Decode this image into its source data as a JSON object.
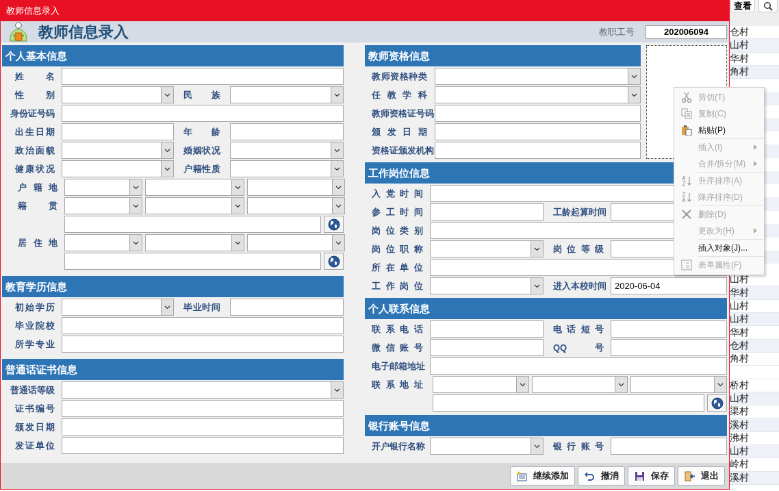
{
  "window": {
    "title": "教师信息录入"
  },
  "header": {
    "title": "教师信息录入",
    "id_label": "教职工号",
    "id_value": "202006094"
  },
  "left_sections": [
    {
      "title": "个人基本信息",
      "rows": [
        {
          "kind": "single",
          "cells": [
            {
              "kind": "label",
              "text": "姓名"
            },
            {
              "kind": "text"
            }
          ]
        },
        {
          "kind": "pair",
          "cells": [
            {
              "kind": "label",
              "text": "性别"
            },
            {
              "kind": "combo"
            },
            {
              "kind": "label",
              "text": "民族"
            },
            {
              "kind": "combo"
            }
          ]
        },
        {
          "kind": "single",
          "cells": [
            {
              "kind": "label",
              "text": "身份证号码"
            },
            {
              "kind": "text"
            }
          ]
        },
        {
          "kind": "pair",
          "cells": [
            {
              "kind": "label",
              "text": "出生日期"
            },
            {
              "kind": "text"
            },
            {
              "kind": "label",
              "text": "年龄"
            },
            {
              "kind": "text"
            }
          ]
        },
        {
          "kind": "pair",
          "cells": [
            {
              "kind": "label",
              "text": "政治面貌"
            },
            {
              "kind": "combo"
            },
            {
              "kind": "label",
              "text": "婚姻状况"
            },
            {
              "kind": "combo"
            }
          ]
        },
        {
          "kind": "pair",
          "cells": [
            {
              "kind": "label",
              "text": "健康状况"
            },
            {
              "kind": "combo"
            },
            {
              "kind": "label",
              "text": "户籍性质"
            },
            {
              "kind": "combo"
            }
          ]
        },
        {
          "kind": "triple",
          "cells": [
            {
              "kind": "label",
              "text": "户籍地"
            },
            {
              "kind": "combo"
            },
            {
              "kind": "combo"
            },
            {
              "kind": "combo"
            }
          ]
        },
        {
          "kind": "triple",
          "cells": [
            {
              "kind": "label",
              "text": "籍贯"
            },
            {
              "kind": "combo"
            },
            {
              "kind": "combo"
            },
            {
              "kind": "combo"
            }
          ]
        },
        {
          "kind": "line",
          "cells": [
            {
              "kind": "text"
            },
            {
              "kind": "globe"
            }
          ]
        },
        {
          "kind": "triple",
          "cells": [
            {
              "kind": "label",
              "text": "居住地"
            },
            {
              "kind": "combo"
            },
            {
              "kind": "combo"
            },
            {
              "kind": "combo"
            }
          ]
        },
        {
          "kind": "line",
          "cells": [
            {
              "kind": "text"
            },
            {
              "kind": "globe"
            }
          ]
        }
      ]
    },
    {
      "title": "教育学历信息",
      "rows": [
        {
          "kind": "pair",
          "cells": [
            {
              "kind": "label",
              "text": "初始学历"
            },
            {
              "kind": "combo"
            },
            {
              "kind": "label",
              "text": "毕业时间"
            },
            {
              "kind": "text"
            }
          ]
        },
        {
          "kind": "single",
          "cells": [
            {
              "kind": "label",
              "text": "毕业院校"
            },
            {
              "kind": "text"
            }
          ]
        },
        {
          "kind": "single",
          "cells": [
            {
              "kind": "label",
              "text": "所学专业"
            },
            {
              "kind": "text"
            }
          ]
        }
      ]
    },
    {
      "title": "普通话证书信息",
      "rows": [
        {
          "kind": "single",
          "cells": [
            {
              "kind": "label",
              "text": "普通话等级"
            },
            {
              "kind": "combo"
            }
          ]
        },
        {
          "kind": "single",
          "cells": [
            {
              "kind": "label",
              "text": "证书编号"
            },
            {
              "kind": "text"
            }
          ]
        },
        {
          "kind": "single",
          "cells": [
            {
              "kind": "label",
              "text": "颁发日期"
            },
            {
              "kind": "text"
            }
          ]
        },
        {
          "kind": "single",
          "cells": [
            {
              "kind": "label",
              "text": "发证单位"
            },
            {
              "kind": "text"
            }
          ]
        }
      ]
    }
  ],
  "right_sections": [
    {
      "title": "教师资格信息",
      "rows": [
        {
          "kind": "single",
          "cells": [
            {
              "kind": "label",
              "text": "教师资格种类"
            },
            {
              "kind": "combo"
            }
          ]
        },
        {
          "kind": "single",
          "cells": [
            {
              "kind": "label",
              "text": "任教学科"
            },
            {
              "kind": "combo"
            }
          ]
        },
        {
          "kind": "single",
          "cells": [
            {
              "kind": "label",
              "text": "教师资格证号码"
            },
            {
              "kind": "text"
            }
          ]
        },
        {
          "kind": "single",
          "cells": [
            {
              "kind": "label",
              "text": "颁发日期"
            },
            {
              "kind": "text"
            }
          ]
        },
        {
          "kind": "single",
          "cells": [
            {
              "kind": "label",
              "text": "资格证颁发机构"
            },
            {
              "kind": "text"
            }
          ]
        }
      ]
    },
    {
      "title": "工作岗位信息",
      "rows": [
        {
          "kind": "single",
          "cells": [
            {
              "kind": "label",
              "text": "入党时间"
            },
            {
              "kind": "text"
            }
          ]
        },
        {
          "kind": "pair",
          "cells": [
            {
              "kind": "label",
              "text": "参工时间"
            },
            {
              "kind": "text"
            },
            {
              "kind": "label",
              "text": "工龄起算时间"
            },
            {
              "kind": "text"
            }
          ]
        },
        {
          "kind": "single",
          "cells": [
            {
              "kind": "label",
              "text": "岗位类别"
            },
            {
              "kind": "text"
            }
          ]
        },
        {
          "kind": "pair",
          "cells": [
            {
              "kind": "label",
              "text": "岗位职称"
            },
            {
              "kind": "combo"
            },
            {
              "kind": "label",
              "text": "岗位等级"
            },
            {
              "kind": "text"
            }
          ]
        },
        {
          "kind": "single",
          "cells": [
            {
              "kind": "label",
              "text": "所在单位"
            },
            {
              "kind": "text"
            }
          ]
        },
        {
          "kind": "pair",
          "cells": [
            {
              "kind": "label",
              "text": "工作岗位"
            },
            {
              "kind": "combo"
            },
            {
              "kind": "label",
              "text": "进入本校时间"
            },
            {
              "kind": "text",
              "value": "2020-06-04"
            }
          ]
        }
      ]
    },
    {
      "title": "个人联系信息",
      "rows": [
        {
          "kind": "pair",
          "cells": [
            {
              "kind": "label",
              "text": "联系电话"
            },
            {
              "kind": "text"
            },
            {
              "kind": "label",
              "text": "电话短号"
            },
            {
              "kind": "text"
            }
          ]
        },
        {
          "kind": "pair",
          "cells": [
            {
              "kind": "label",
              "text": "微信账号"
            },
            {
              "kind": "text"
            },
            {
              "kind": "label",
              "text": "QQ号"
            },
            {
              "kind": "text"
            }
          ]
        },
        {
          "kind": "single",
          "cells": [
            {
              "kind": "label",
              "text": "电子邮箱地址"
            },
            {
              "kind": "text"
            }
          ]
        },
        {
          "kind": "triple",
          "cells": [
            {
              "kind": "label",
              "text": "联系地址"
            },
            {
              "kind": "combo"
            },
            {
              "kind": "combo"
            },
            {
              "kind": "combo"
            }
          ]
        },
        {
          "kind": "line",
          "cells": [
            {
              "kind": "text"
            },
            {
              "kind": "globe"
            }
          ]
        }
      ]
    },
    {
      "title": "银行账号信息",
      "rows": [
        {
          "kind": "pair",
          "cells": [
            {
              "kind": "label",
              "text": "开户银行名称"
            },
            {
              "kind": "combo"
            },
            {
              "kind": "label",
              "text": "银行账号"
            },
            {
              "kind": "text"
            }
          ]
        }
      ]
    }
  ],
  "buttons": [
    {
      "kind": "add",
      "label": "继续添加"
    },
    {
      "kind": "undo",
      "label": "撤消"
    },
    {
      "kind": "save",
      "label": "保存"
    },
    {
      "kind": "exit",
      "label": "退出"
    }
  ],
  "context_menu": [
    {
      "kind": "cut",
      "label": "剪切(T)",
      "disabled": true,
      "submenu": false
    },
    {
      "kind": "copy",
      "label": "复制(C)",
      "disabled": true,
      "submenu": false
    },
    {
      "kind": "paste",
      "label": "粘贴(P)",
      "disabled": false,
      "submenu": false
    },
    {
      "kind": "separator"
    },
    {
      "kind": "plain",
      "label": "插入(I)",
      "disabled": true,
      "submenu": true
    },
    {
      "kind": "plain",
      "label": "合并/拆分(M)",
      "disabled": true,
      "submenu": true
    },
    {
      "kind": "separator"
    },
    {
      "kind": "sortup",
      "label": "升序排序(A)",
      "disabled": true,
      "submenu": false
    },
    {
      "kind": "sortdown",
      "label": "降序排序(D)",
      "disabled": true,
      "submenu": false
    },
    {
      "kind": "separator"
    },
    {
      "kind": "delete",
      "label": "删除(D)",
      "disabled": true,
      "submenu": false
    },
    {
      "kind": "plain",
      "label": "更改为(H)",
      "disabled": true,
      "submenu": true
    },
    {
      "kind": "separator"
    },
    {
      "kind": "plain",
      "label": "插入对象(J)...",
      "disabled": false,
      "submenu": false
    },
    {
      "kind": "separator"
    },
    {
      "kind": "props",
      "label": "表单属性(F)",
      "disabled": true,
      "submenu": false
    }
  ],
  "background_window": {
    "view_button": "查看",
    "upper_rows": [
      {
        "text": "仓村"
      },
      {
        "text": "山村"
      },
      {
        "text": "华村"
      },
      {
        "text": "角村"
      }
    ],
    "lower_rows": [
      {
        "text": "山村"
      },
      {
        "text": "华村"
      },
      {
        "text": "山村"
      },
      {
        "text": "山村"
      },
      {
        "text": "华村"
      },
      {
        "text": "仓村"
      },
      {
        "text": "角村"
      },
      {
        "kind": "empty"
      },
      {
        "text": "桥村"
      },
      {
        "text": "山村"
      },
      {
        "text": "渠村"
      },
      {
        "text": "溪村"
      },
      {
        "text": "沸村"
      },
      {
        "text": "山村"
      },
      {
        "text": "岭村"
      },
      {
        "text": "溪村"
      }
    ]
  }
}
